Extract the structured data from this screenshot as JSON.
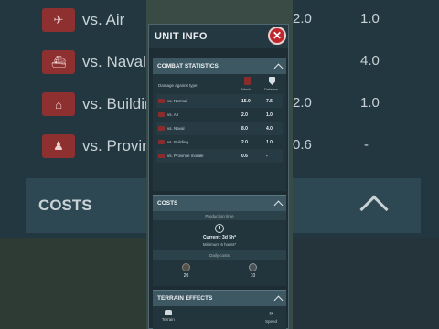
{
  "background": {
    "rows": [
      {
        "label": "vs. Air",
        "attack": "2.0",
        "defense": "1.0"
      },
      {
        "label": "vs. Naval",
        "attack": "",
        "defense": "4.0"
      },
      {
        "label": "vs. Building",
        "attack": "2.0",
        "defense": "1.0"
      },
      {
        "label": "vs. Province",
        "attack": "0.6",
        "defense": "-"
      }
    ],
    "costs_label": "COSTS"
  },
  "dialog": {
    "title": "UNIT INFO",
    "close_glyph": "✕"
  },
  "combat": {
    "title": "COMBAT STATISTICS",
    "damage_label": "Damage against type",
    "attack_label": "Attack",
    "defense_label": "Defense",
    "rows": [
      {
        "label": "vs. Normal",
        "attack": "15.0",
        "defense": "7.5"
      },
      {
        "label": "vs. Air",
        "attack": "2.0",
        "defense": "1.0"
      },
      {
        "label": "vs. Naval",
        "attack": "8.0",
        "defense": "4.0"
      },
      {
        "label": "vs. Building",
        "attack": "2.0",
        "defense": "1.0"
      },
      {
        "label": "vs. Province morale",
        "attack": "0.6",
        "defense": "-"
      }
    ]
  },
  "costs": {
    "title": "COSTS",
    "production_time_label": "Production time",
    "current": "Current: 3d 5h*",
    "minimum": "Minimum 6 hours*",
    "daily_costs_label": "Daily costs",
    "items": [
      {
        "icon": "supplies-icon",
        "value": "20"
      },
      {
        "icon": "metal-icon",
        "value": "10"
      }
    ]
  },
  "terrain": {
    "title": "TERRAIN EFFECTS",
    "terrain_label": "Terrain",
    "speed_label": "Speed"
  },
  "colors": {
    "close": "#c0272d",
    "section_header": "#3d5863",
    "panel": "#22353d"
  }
}
